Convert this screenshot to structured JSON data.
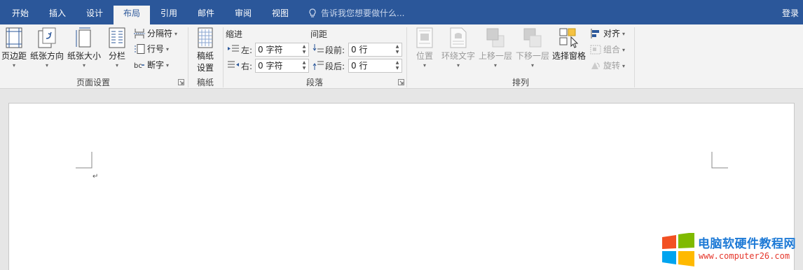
{
  "tabs": [
    {
      "label": "开始",
      "active": false
    },
    {
      "label": "插入",
      "active": false
    },
    {
      "label": "设计",
      "active": false
    },
    {
      "label": "布局",
      "active": true
    },
    {
      "label": "引用",
      "active": false
    },
    {
      "label": "邮件",
      "active": false
    },
    {
      "label": "审阅",
      "active": false
    },
    {
      "label": "视图",
      "active": false
    }
  ],
  "tell_me": "告诉我您想要做什么...",
  "login": "登录",
  "page_setup": {
    "margins": "页边距",
    "orientation": "纸张方向",
    "size": "纸张大小",
    "columns": "分栏",
    "breaks": "分隔符",
    "line_numbers": "行号",
    "hyphenation": "断字",
    "group_label": "页面设置"
  },
  "draft_paper": {
    "button_line1": "稿纸",
    "button_line2": "设置",
    "group_label": "稿纸"
  },
  "paragraph": {
    "indent_heading": "缩进",
    "spacing_heading": "间距",
    "left_label": "左:",
    "right_label": "右:",
    "before_label": "段前:",
    "after_label": "段后:",
    "left_value": "0 字符",
    "right_value": "0 字符",
    "before_value": "0 行",
    "after_value": "0 行",
    "group_label": "段落"
  },
  "arrange": {
    "position": "位置",
    "wrap_text": "环绕文字",
    "bring_forward": "上移一层",
    "send_backward": "下移一层",
    "selection_pane": "选择窗格",
    "align": "对齐",
    "group": "组合",
    "rotate": "旋转",
    "group_label": "排列"
  },
  "document": {
    "paragraph_mark": "↵"
  },
  "watermark": {
    "title": "电脑软硬件教程网",
    "url": "www.computer26.com"
  },
  "colors": {
    "tab_bar": "#2b579a",
    "ribbon": "#f3f3f3",
    "background": "#e6e6e6"
  }
}
